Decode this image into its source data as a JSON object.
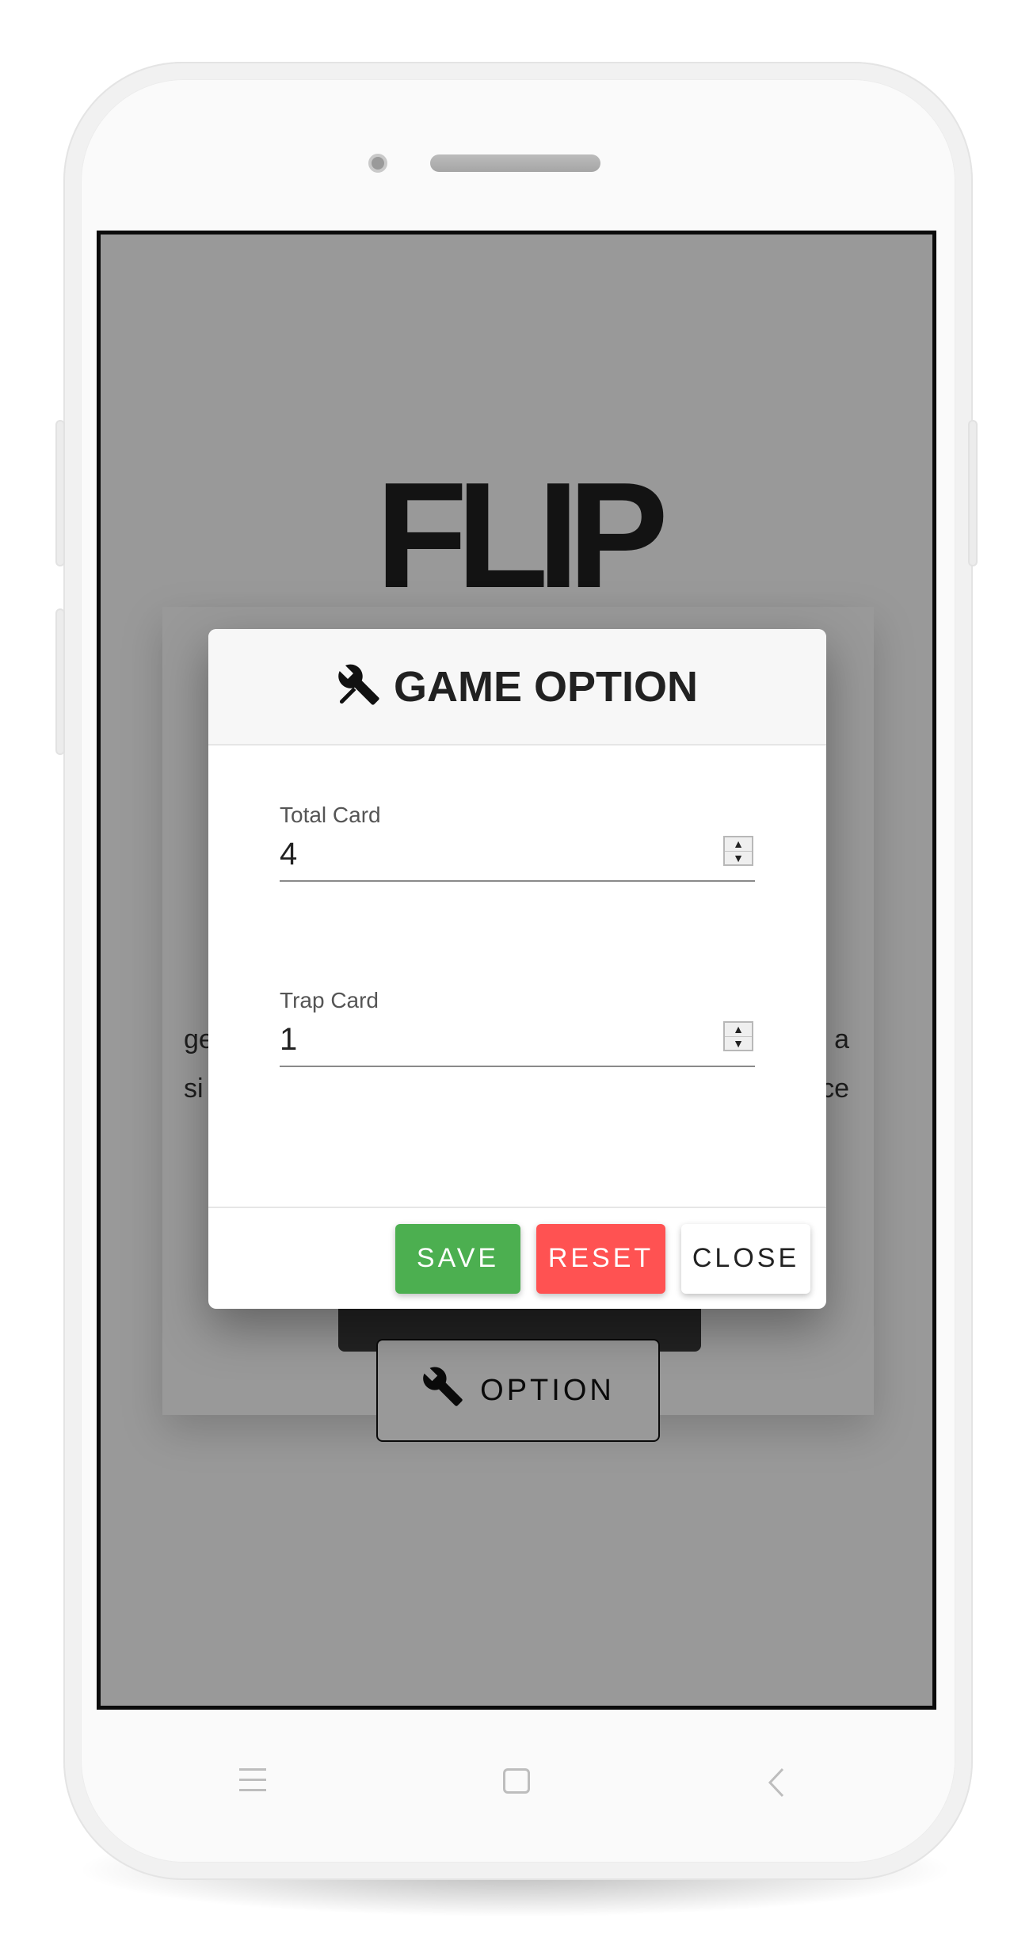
{
  "app": {
    "title": "FLIP",
    "description": "ge a si ce",
    "option_button_label": "OPTION",
    "option_icon": "tools-icon"
  },
  "modal": {
    "title": "GAME OPTION",
    "title_icon": "tools-icon",
    "fields": [
      {
        "label": "Total Card",
        "value": "4"
      },
      {
        "label": "Trap Card",
        "value": "1"
      }
    ],
    "buttons": {
      "save": "SAVE",
      "reset": "RESET",
      "close": "CLOSE"
    }
  },
  "navbar": {
    "icons": [
      "menu-icon",
      "home-icon",
      "back-icon"
    ]
  },
  "colors": {
    "save": "#4caf50",
    "reset": "#ff5252",
    "overlay": "rgba(0,0,0,0.40)"
  }
}
